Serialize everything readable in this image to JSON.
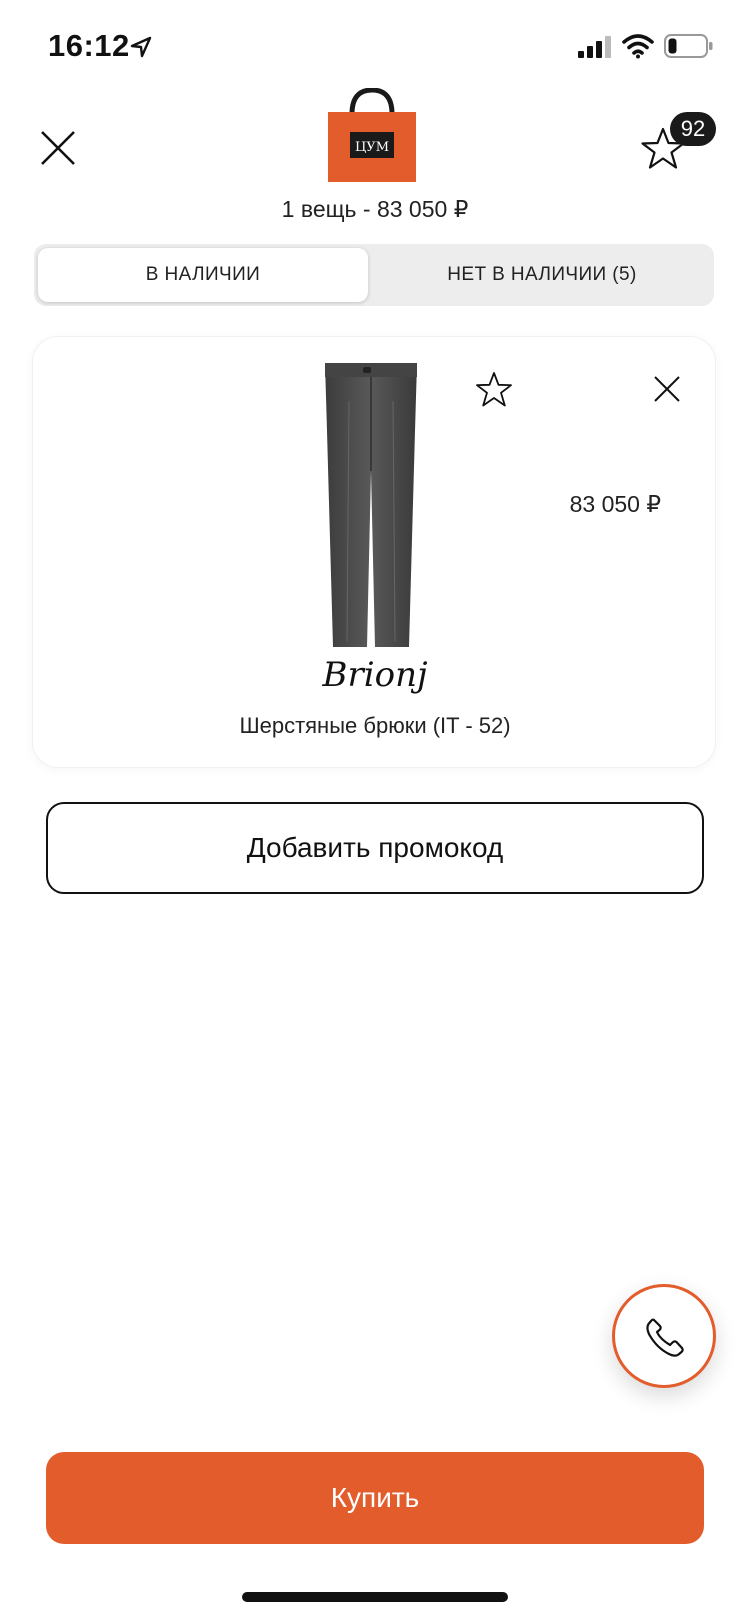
{
  "status_bar": {
    "time": "16:12"
  },
  "header": {
    "logo_text": "ЦУМ",
    "favorites_count": "92"
  },
  "cart": {
    "summary": "1 вещь - 83 050 ₽"
  },
  "tabs": [
    {
      "label": "В НАЛИЧИИ",
      "active": true
    },
    {
      "label": "НЕТ В НАЛИЧИИ (5)",
      "active": false
    }
  ],
  "item": {
    "brand": "Brionj",
    "title": "Шерстяные брюки (IT - 52)",
    "price": "83 050 ₽"
  },
  "actions": {
    "promo_label": "Добавить промокод",
    "buy_label": "Купить"
  },
  "colors": {
    "accent": "#e35d2c",
    "segment_bg": "#ededed",
    "dark": "#1a1a1a"
  },
  "icons": [
    "location-arrow-icon",
    "cellular-signal-icon",
    "wifi-icon",
    "battery-icon",
    "close-icon",
    "shopping-bag-logo",
    "star-icon",
    "phone-icon"
  ]
}
